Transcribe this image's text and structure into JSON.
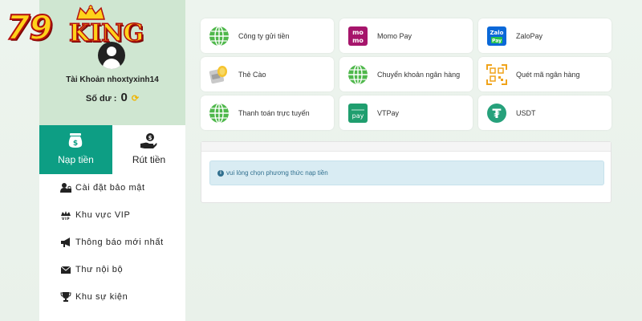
{
  "logo": {
    "number": "79",
    "word": "KING"
  },
  "profile": {
    "account_label": "Tài Khoản nhoxtyxinh14",
    "balance_label": "Số dư :",
    "balance_value": "0"
  },
  "tabs": [
    {
      "label": "Nạp tiền",
      "active": true
    },
    {
      "label": "Rút tiền",
      "active": false
    }
  ],
  "menu": [
    {
      "label": "Cài đặt bảo mật",
      "icon": "user-lock-icon"
    },
    {
      "label": "Khu vực VIP",
      "icon": "vip-crown-icon"
    },
    {
      "label": "Thông báo mới nhất",
      "icon": "megaphone-icon"
    },
    {
      "label": "Thư nội bộ",
      "icon": "envelope-icon"
    },
    {
      "label": "Khu sự kiện",
      "icon": "trophy-icon"
    }
  ],
  "payments": [
    {
      "label": "Công ty gửi tiền",
      "icon": "globe-icon"
    },
    {
      "label": "Momo Pay",
      "icon": "momo-icon",
      "icon_text": [
        "mo",
        "mo"
      ]
    },
    {
      "label": "ZaloPay",
      "icon": "zalopay-icon",
      "icon_text": [
        "Zalo",
        "Pay"
      ]
    },
    {
      "label": "Thẻ Cào",
      "icon": "scratch-card-icon"
    },
    {
      "label": "Chuyển khoản ngân hàng",
      "icon": "globe-icon"
    },
    {
      "label": "Quét mã ngân hàng",
      "icon": "qr-scan-icon"
    },
    {
      "label": "Thanh toán trực tuyến",
      "icon": "globe-icon"
    },
    {
      "label": "VTPay",
      "icon": "vtpay-icon",
      "icon_text": "pay"
    },
    {
      "label": "USDT",
      "icon": "tether-icon",
      "icon_text": "₮"
    }
  ],
  "info": {
    "message": "vui lòng chọn phương thức nạp tiền"
  },
  "colors": {
    "accent": "#0d9e84",
    "profile_bg": "#cfe6d1",
    "info_bg": "#d9ecf3",
    "info_text": "#31708f"
  }
}
